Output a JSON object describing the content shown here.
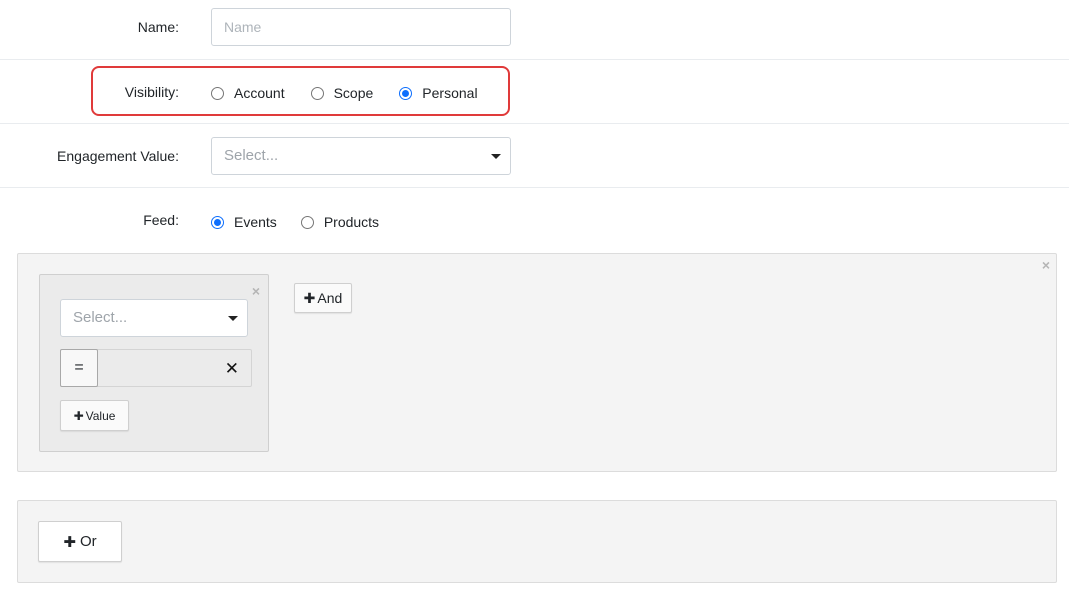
{
  "form": {
    "name": {
      "label": "Name:",
      "placeholder": "Name",
      "value": ""
    },
    "visibility": {
      "label": "Visibility:",
      "options": [
        {
          "label": "Account",
          "checked": false
        },
        {
          "label": "Scope",
          "checked": false
        },
        {
          "label": "Personal",
          "checked": true
        }
      ]
    },
    "engagement": {
      "label": "Engagement Value:",
      "placeholder": "Select..."
    },
    "feed": {
      "label": "Feed:",
      "options": [
        {
          "label": "Events",
          "checked": true
        },
        {
          "label": "Products",
          "checked": false
        }
      ]
    }
  },
  "rule_group": {
    "close_symbol": "×",
    "condition": {
      "close_symbol": "×",
      "field_placeholder": "Select...",
      "operator": "=",
      "value_clear": "✕",
      "add_value_plus": "✚",
      "add_value_label": "Value"
    },
    "and_plus": "✚",
    "and_label": "And"
  },
  "or_group": {
    "plus": "✚",
    "label": "Or"
  },
  "colors": {
    "accent": "#0d6efd",
    "highlight": "#e03a3a",
    "panel_bg": "#f4f4f4"
  }
}
